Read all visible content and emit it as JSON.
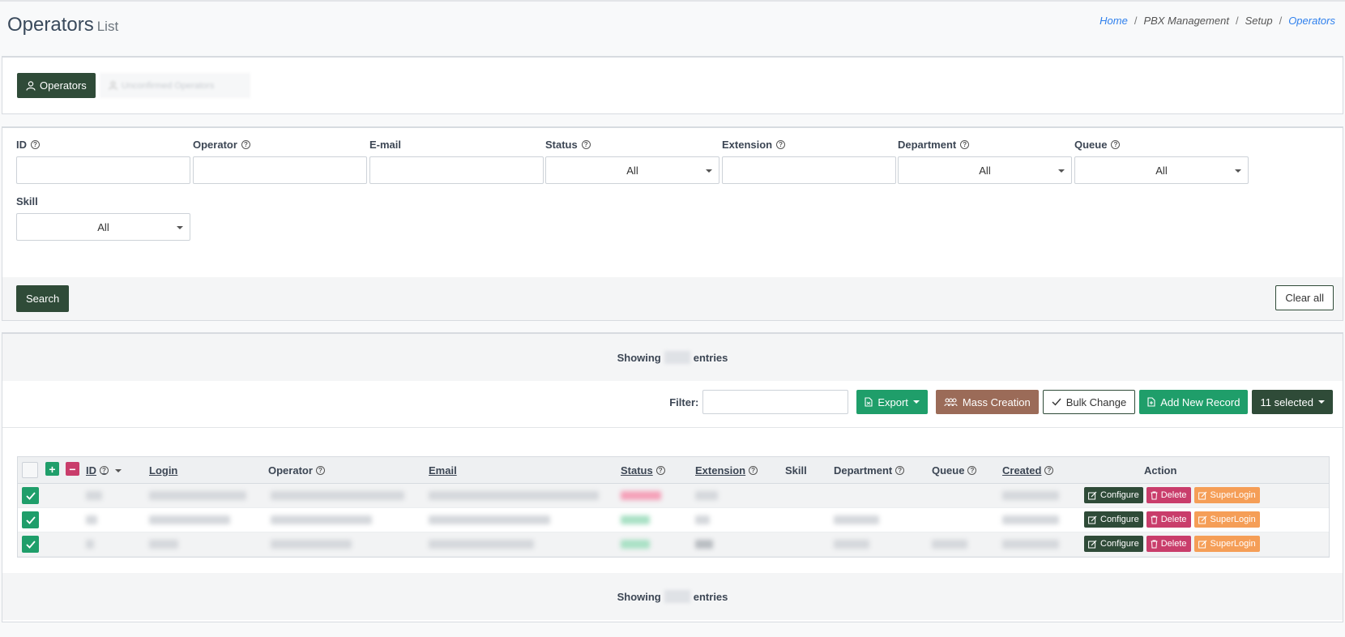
{
  "page": {
    "title": "Operators",
    "subtitle": "List"
  },
  "breadcrumb": {
    "items": [
      "Home",
      "PBX Management",
      "Setup",
      "Operators"
    ]
  },
  "tabs": {
    "active_label": "Operators",
    "blurred_label": "Unconfirmed Operators"
  },
  "filters": {
    "id_label": "ID",
    "operator_label": "Operator",
    "email_label": "E-mail",
    "status_label": "Status",
    "status_value": "All",
    "extension_label": "Extension",
    "department_label": "Department",
    "department_value": "All",
    "queue_label": "Queue",
    "queue_value": "All",
    "skill_label": "Skill",
    "skill_value": "All",
    "search_button": "Search",
    "clear_button": "Clear all"
  },
  "list": {
    "showing_prefix": "Showing",
    "showing_suffix": "entries",
    "filter_label": "Filter:",
    "export_button": "Export",
    "mass_creation_button": "Mass Creation",
    "bulk_change_button": "Bulk Change",
    "add_new_button": "Add New Record",
    "selected_button": "11 selected"
  },
  "table": {
    "columns": {
      "id": "ID",
      "login": "Login",
      "operator": "Operator",
      "email": "Email",
      "status": "Status",
      "extension": "Extension",
      "skill": "Skill",
      "department": "Department",
      "queue": "Queue",
      "created": "Created",
      "action": "Action"
    },
    "actions": {
      "configure": "Configure",
      "delete": "Delete",
      "superlogin": "SuperLogin"
    }
  },
  "colors": {
    "primary_dark_green": "#2f4b38",
    "green": "#1f9e6a",
    "brown": "#9b6b58",
    "pink": "#c93d6b",
    "orange": "#f59e57",
    "link_blue": "#2f80ed"
  }
}
